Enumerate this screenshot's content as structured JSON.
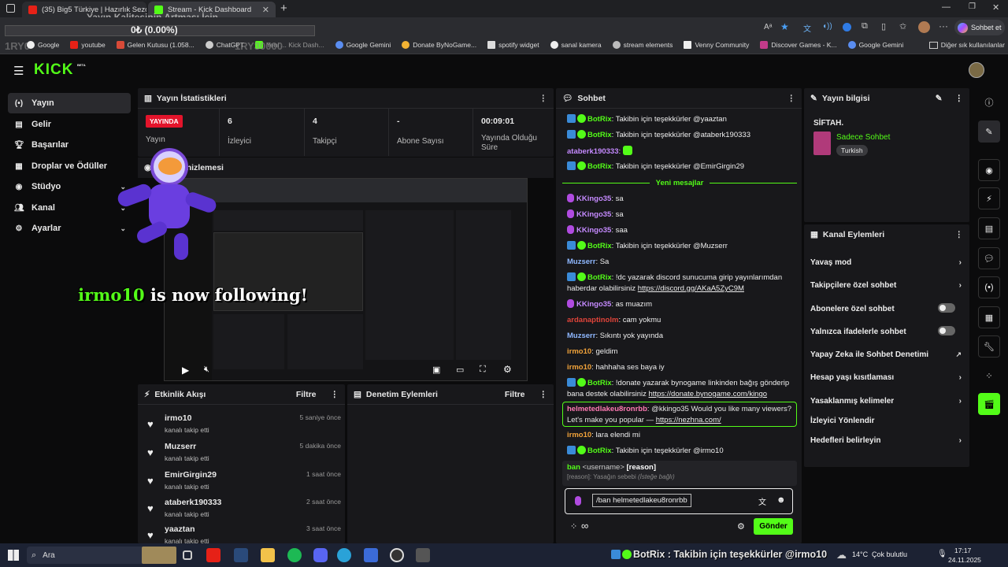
{
  "browser": {
    "tabs": [
      {
        "title": "(35) Big5 Türkiye | Hazırlık Sezonu"
      },
      {
        "title": "Stream - Kick Dashboard"
      }
    ],
    "overlay_title": "Yayın Kalitesinin Artması İçin",
    "overlay_value": "0₺ (0.00%)",
    "overlay_side": "1RY0",
    "overlay_side2": "1RY30000",
    "sohbet_et": "Sohbet et",
    "bookmarks": [
      "Google",
      "youtube",
      "Gelen Kutusu (1.058...",
      "ChatGPT",
      "Yeni ... Kick Dash...",
      "Google Gemini",
      "Donate ByNoGame...",
      "spotify widget",
      "sanal kamera",
      "stream elements",
      "Venny Community",
      "Discover Games - K...",
      "Google Gemini"
    ],
    "other_bookmarks": "Diğer sık kullanılanlar"
  },
  "brand": {
    "logo": "KICK",
    "beta": "BETA"
  },
  "sidebar": {
    "items": [
      {
        "label": "Yayın",
        "icon": "broadcast-icon"
      },
      {
        "label": "Gelir",
        "icon": "revenue-icon"
      },
      {
        "label": "Başarılar",
        "icon": "trophy-icon"
      },
      {
        "label": "Droplar ve Ödüller",
        "icon": "gift-icon"
      },
      {
        "label": "Stüdyo",
        "icon": "camera-icon"
      },
      {
        "label": "Kanal",
        "icon": "users-icon"
      },
      {
        "label": "Ayarlar",
        "icon": "gear-icon"
      }
    ]
  },
  "stats": {
    "title": "Yayın İstatistikleri",
    "live": "YAYINDA",
    "live_label": "Yayın",
    "items": [
      {
        "value": "6",
        "label": "İzleyici"
      },
      {
        "value": "4",
        "label": "Takipçi"
      },
      {
        "value": "-",
        "label": "Abone Sayısı"
      },
      {
        "value": "00:09:01",
        "label": "Yayında Olduğu Süre"
      }
    ]
  },
  "preview": {
    "title": "Yayın Önizlemesi",
    "alert_name": "irmo10",
    "alert_text": "is now following!"
  },
  "activity": {
    "title": "Etkinlik Akışı",
    "filter": "Filtre",
    "items": [
      {
        "name": "irmo10",
        "sub": "kanalı takip etti",
        "time": "5 saniye önce"
      },
      {
        "name": "Muzserr",
        "sub": "kanalı takip etti",
        "time": "5 dakika önce"
      },
      {
        "name": "EmirGirgin29",
        "sub": "kanalı takip etti",
        "time": "1 saat önce"
      },
      {
        "name": "ataberk190333",
        "sub": "kanalı takip etti",
        "time": "2 saat önce"
      },
      {
        "name": "yaaztan",
        "sub": "kanalı takip etti",
        "time": "3 saat önce"
      }
    ]
  },
  "moderation": {
    "title": "Denetim Eylemleri",
    "filter": "Filtre"
  },
  "chat": {
    "title": "Sohbet",
    "new_messages": "Yeni mesajlar",
    "messages": [
      {
        "user": "BotRix",
        "text": "Takibin için teşekkürler @yaaztan"
      },
      {
        "user": "BotRix",
        "text": "Takibin için teşekkürler @ataberk190333"
      },
      {
        "user": "ataberk190333",
        "text": ""
      },
      {
        "user": "BotRix",
        "text": "Takibin için teşekkürler @EmirGirgin29"
      },
      {
        "user": "KKingo35",
        "text": "sa"
      },
      {
        "user": "KKingo35",
        "text": "sa"
      },
      {
        "user": "KKingo35",
        "text": "saa"
      },
      {
        "user": "BotRix",
        "text": "Takibin için teşekkürler @Muzserr"
      },
      {
        "user": "Muzserr",
        "text": "Sa"
      },
      {
        "user": "BotRix",
        "text": "!dc yazarak discord sunucuma girip yayınlarımdan haberdar olabilirsiniz",
        "link": "https://discord.gg/AKaA5ZyC9M"
      },
      {
        "user": "KKingo35",
        "text": "as muazım"
      },
      {
        "user": "ardanaptinolm",
        "text": "cam yokmu"
      },
      {
        "user": "Muzserr",
        "text": "Sıkıntı yok yayında"
      },
      {
        "user": "irmo10",
        "text": "geldim"
      },
      {
        "user": "irmo10",
        "text": "hahhaha ses baya iy"
      },
      {
        "user": "BotRix",
        "text": "!donate yazarak bynogame linkinden bağış gönderip bana destek olabilirsiniz",
        "link": "https://donate.bynogame.com/kingo"
      },
      {
        "user": "helmetedlakeu8ronrbb",
        "text": "@kkingo35 Would you like many viewers? Let's make you popular —",
        "link": "https://nezhna.com/"
      },
      {
        "user": "irmo10",
        "text": "lara elendi mi"
      },
      {
        "user": "BotRix",
        "text": "Takibin için teşekkürler @irmo10"
      }
    ],
    "cmd_hint": "ban",
    "cmd_args": "<username>",
    "cmd_reason": "[reason]",
    "cmd_desc": "[reason]: Yasağın sebebi",
    "cmd_optional": "(İsteğe bağlı)",
    "input_value": "/ban helmetedlakeu8ronrbb",
    "send": "Gönder"
  },
  "info": {
    "title": "Yayın bilgisi",
    "stream_title": "SİFTAH.",
    "category": "Sadece Sohbet",
    "tag": "Turkish"
  },
  "channel_actions": {
    "title": "Kanal Eylemleri",
    "items": [
      "Yavaş mod",
      "Takipçilere özel sohbet",
      "Abonelere özel sohbet",
      "Yalnızca ifadelerle sohbet",
      "Yapay Zeka ile Sohbet Denetimi",
      "Hesap yaşı kısıtlaması",
      "Yasaklanmış kelimeler",
      "İzleyici Yönlendir",
      "Hedefleri belirleyin"
    ]
  },
  "taskbar": {
    "search": "Ara",
    "ticker": "BotRix : Takibin için teşekkürler @irmo10",
    "weather": "14°C",
    "weather_text": "Çok bulutlu",
    "time": "17:17",
    "date": "24.11.2025"
  },
  "colors": {
    "kick_green": "#53fc18",
    "panel": "#18181b",
    "bg": "#0b0b0c",
    "botrix": "#53fc18",
    "live_red": "#e3142b"
  }
}
